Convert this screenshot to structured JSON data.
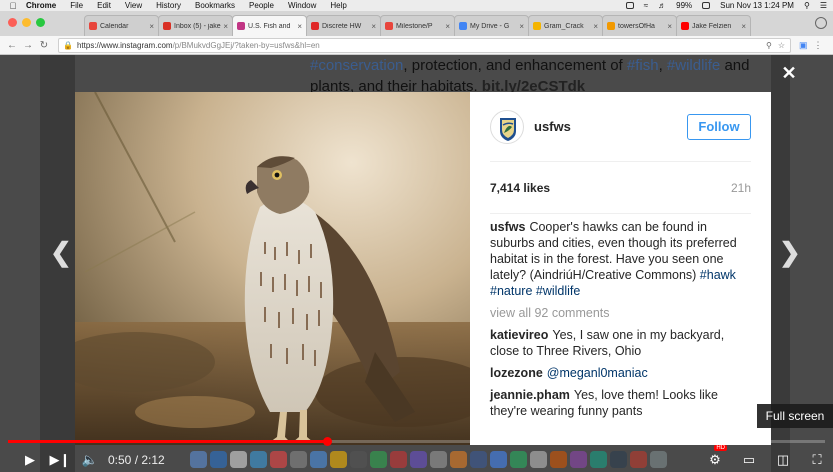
{
  "menubar": {
    "app": "Chrome",
    "items": [
      "File",
      "Edit",
      "View",
      "History",
      "Bookmarks",
      "People",
      "Window",
      "Help"
    ],
    "battery": "99%",
    "clock": "Sun Nov 13  1:24 PM"
  },
  "tabs": [
    {
      "label": "Calendar",
      "color": "#e8453c"
    },
    {
      "label": "Inbox (5) - jake",
      "color": "#d93025"
    },
    {
      "label": "U.S. Fish and",
      "color": "#c13584"
    },
    {
      "label": "Discrete HW",
      "color": "#e02828"
    },
    {
      "label": "Milestone/P",
      "color": "#e8453c"
    },
    {
      "label": "My Drive - G",
      "color": "#4285f4"
    },
    {
      "label": "Gram_Crack",
      "color": "#f4b400"
    },
    {
      "label": "towersOfHa",
      "color": "#f29900"
    },
    {
      "label": "Jake Felzien",
      "color": "#ff0000"
    }
  ],
  "toolbar": {
    "url_main": "https://www.instagram.com",
    "url_rest": "/p/BMukvdGgJEj/?taken-by=usfws&hl=en"
  },
  "background": {
    "line1_prefix": "#conservation",
    "line1_mid": ", protection, and enhancement of ",
    "line1_tag2": "#fish",
    "line1_sep": ", ",
    "line1_tag3": "#wildlife",
    "line1_end": " and",
    "line2": "plants, and their habitats. ",
    "line2_link": "bit.ly/2eCSTdk"
  },
  "post": {
    "username": "usfws",
    "follow_label": "Follow",
    "likes": "7,414 likes",
    "time": "21h",
    "caption_author": "usfws",
    "caption_text": "Cooper's hawks can be found in suburbs and cities, even though its preferred habitat is in the forest. Have you seen one lately? (AindriúH/Creative Commons) ",
    "caption_tags": [
      "#hawk",
      "#nature",
      "#wildlife"
    ],
    "view_all": "view all 92 comments",
    "comments": [
      {
        "author": "katievireo",
        "text": "Yes, I saw one in my backyard, close to Three Rivers, Ohio",
        "mention": ""
      },
      {
        "author": "lozezone",
        "text": "",
        "mention": "@meganl0maniac"
      },
      {
        "author": "jeannie.pham",
        "text": "Yes, love them! Looks like they're wearing funny pants",
        "mention": ""
      }
    ]
  },
  "player": {
    "time": "0:50 / 2:12",
    "progress_fraction": 0.39,
    "tooltip": "Full screen",
    "hd": "HD"
  }
}
